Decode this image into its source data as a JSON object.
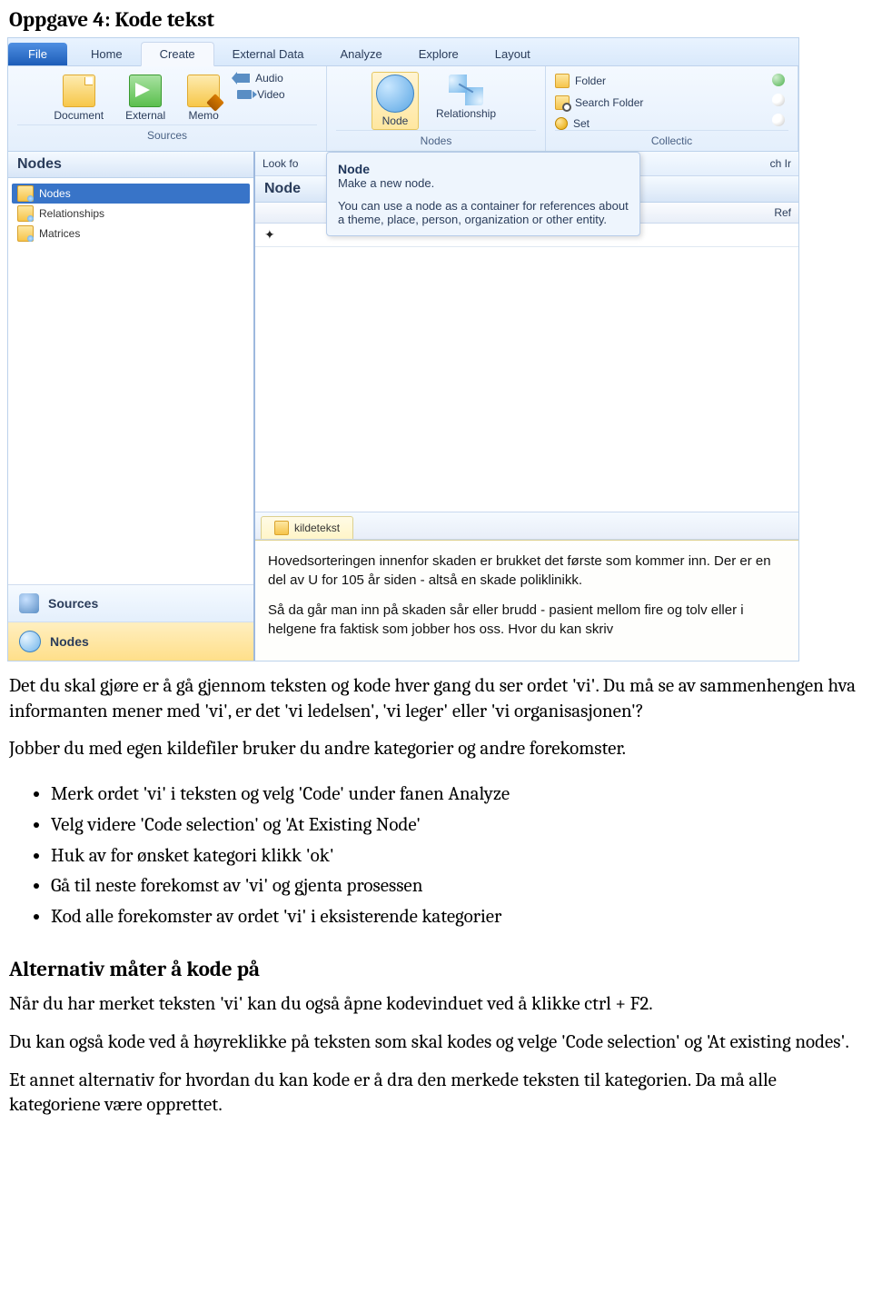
{
  "page_title": "Oppgave 4: Kode tekst",
  "ribbon": {
    "file": "File",
    "tabs": [
      "Home",
      "Create",
      "External Data",
      "Analyze",
      "Explore",
      "Layout"
    ],
    "active_tab": "Create",
    "groups": {
      "sources": {
        "label": "Sources",
        "items": [
          "Document",
          "External",
          "Memo",
          "Audio",
          "Video"
        ]
      },
      "nodes": {
        "label": "Nodes",
        "items": [
          "Node",
          "Relationship"
        ]
      },
      "collections": {
        "label": "Collectic",
        "items": [
          "Folder",
          "Search Folder",
          "Set"
        ]
      }
    }
  },
  "left_panel": {
    "title": "Nodes",
    "tree": [
      "Nodes",
      "Relationships",
      "Matrices"
    ],
    "nav": [
      "Sources",
      "Nodes"
    ]
  },
  "lookbar": {
    "left": "Look fo",
    "right": "ch Ir"
  },
  "nodes_panel_title": "Node",
  "table_head_right": "Ref",
  "tooltip": {
    "title": "Node",
    "subtitle": "Make a new node.",
    "body": "You can use a node as a container for references about a theme, place, person, organization or other entity."
  },
  "doc_tab": "kildetekst",
  "doc_paragraphs": [
    "Hovedsorteringen innenfor skaden er brukket det første som kommer inn. Der er en del av U for 105 år siden - altså en skade poliklinikk.",
    "Så da går man inn på skaden sår eller brudd - pasient mellom fire og tolv eller i helgene fra faktisk som jobber hos oss. Hvor du kan skriv"
  ],
  "prose": {
    "p1": "Det du skal gjøre er å gå gjennom teksten og kode hver gang du ser ordet 'vi'. Du må se av sammenhengen hva informanten mener med 'vi', er det 'vi ledelsen', 'vi leger' eller 'vi organisasjonen'?",
    "p2": "Jobber du med egen kildefiler bruker du andre kategorier og andre forekomster.",
    "bullets": [
      "Merk ordet 'vi' i teksten og velg 'Code' under fanen Analyze",
      "Velg videre 'Code selection' og 'At Existing Node'",
      "Huk av for ønsket kategori klikk 'ok'",
      "Gå til neste forekomst av 'vi' og gjenta prosessen",
      "Kod alle forekomster av ordet 'vi' i eksisterende kategorier"
    ],
    "h2": "Alternativ måter å kode på",
    "p3": "Når du har merket teksten 'vi' kan du også åpne kodevinduet ved å klikke ctrl + F2.",
    "p4": "Du kan også kode ved å høyreklikke på teksten som skal kodes og velge 'Code selection' og 'At existing nodes'.",
    "p5": "Et annet alternativ for hvordan du kan kode er å dra den merkede teksten til kategorien. Da må alle kategoriene være opprettet."
  }
}
